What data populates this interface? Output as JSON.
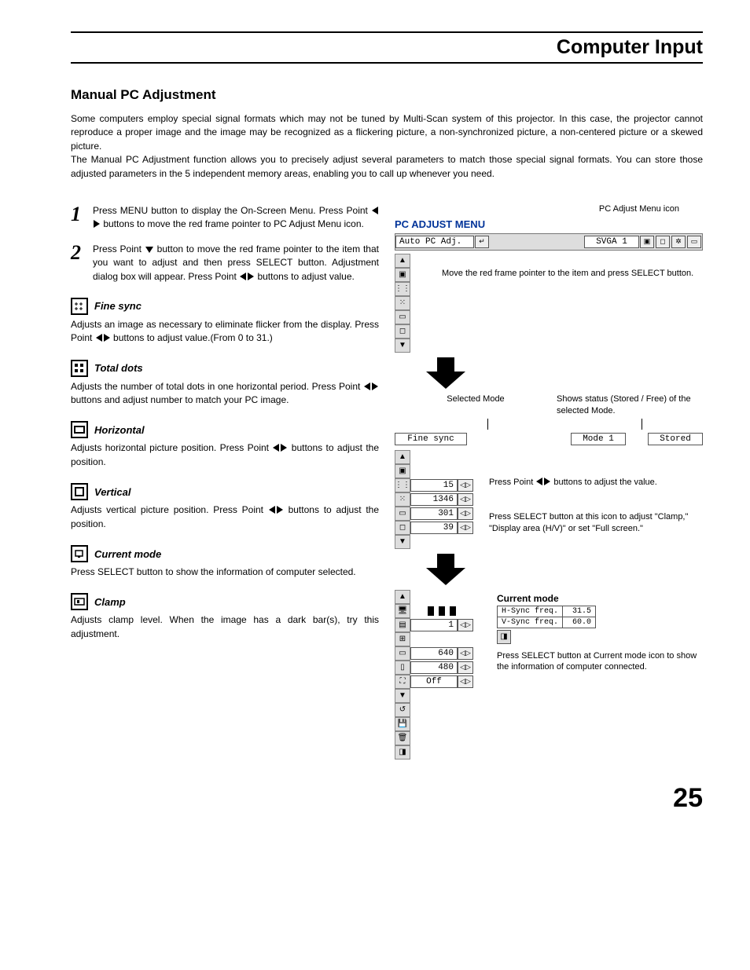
{
  "header": {
    "title": "Computer Input"
  },
  "section": {
    "title": "Manual PC Adjustment"
  },
  "intro": {
    "p1": "Some computers employ special signal formats which may not be tuned by Multi-Scan system of this projector.  In this case, the projector cannot reproduce a proper image and the image may be recognized as a flickering picture, a non-synchronized picture, a non-centered picture or a skewed picture.",
    "p2": "The Manual PC Adjustment function allows you to precisely adjust several parameters to match those special signal formats. You can store those adjusted parameters in the 5 independent memory areas, enabling you to call up whenever you need."
  },
  "steps": [
    {
      "num": "1",
      "text_a": "Press MENU button to display the On-Screen Menu. Press Point ",
      "text_b": " buttons to move the red frame pointer to PC Adjust Menu icon."
    },
    {
      "num": "2",
      "text_a": "Press Point ",
      "text_b": " button to move the red frame pointer to the item that you want to adjust and then press SELECT button. Adjustment dialog box will appear.  Press Point ",
      "text_c": " buttons to adjust value."
    }
  ],
  "items": {
    "fine_sync": {
      "title": "Fine sync",
      "desc_a": "Adjusts an image as necessary to eliminate flicker from the display. Press Point ",
      "desc_b": " buttons to adjust value.(From 0 to 31.)"
    },
    "total_dots": {
      "title": "Total dots",
      "desc_a": "Adjusts the number of total dots in one horizontal period.  Press Point ",
      "desc_b": " buttons and adjust number to match your PC image."
    },
    "horizontal": {
      "title": "Horizontal",
      "desc_a": "Adjusts horizontal picture position.  Press Point ",
      "desc_b": " buttons to adjust the position."
    },
    "vertical": {
      "title": "Vertical",
      "desc_a": "Adjusts vertical picture position.  Press Point ",
      "desc_b": " buttons to adjust the position."
    },
    "current_mode": {
      "title": "Current mode",
      "desc": "Press SELECT button to show the information of computer selected."
    },
    "clamp": {
      "title": "Clamp",
      "desc": "Adjusts clamp level.  When the image has a dark bar(s), try this adjustment."
    }
  },
  "right": {
    "icon_caption": "PC Adjust Menu icon",
    "menu_title": "PC ADJUST MENU",
    "menubar": {
      "left_label": "Auto PC Adj.",
      "mode_label": "SVGA 1"
    },
    "annot1": "Move the red frame pointer to the item and press SELECT button.",
    "selected_mode_label": "Selected Mode",
    "status_label": "Shows status (Stored / Free) of the selected Mode.",
    "selrow": {
      "left": "Fine sync",
      "mid": "Mode 1",
      "right": "Stored"
    },
    "values1": [
      "15",
      "1346",
      "301",
      "39"
    ],
    "annot2": "Press Point ◀▶ buttons to adjust the value.",
    "annot3": "Press SELECT button at this icon to adjust \"Clamp,\" \"Display area (H/V)\" or set \"Full screen.\"",
    "current_mode_title": "Current mode",
    "cm_table": [
      {
        "label": "H-Sync freq.",
        "value": "31.5"
      },
      {
        "label": "V-Sync freq.",
        "value": "60.0"
      }
    ],
    "cm_note": "Press SELECT button at Current mode icon to show the information of computer connected.",
    "values2": [
      "1",
      "640",
      "480",
      "Off"
    ]
  },
  "page_number": "25"
}
